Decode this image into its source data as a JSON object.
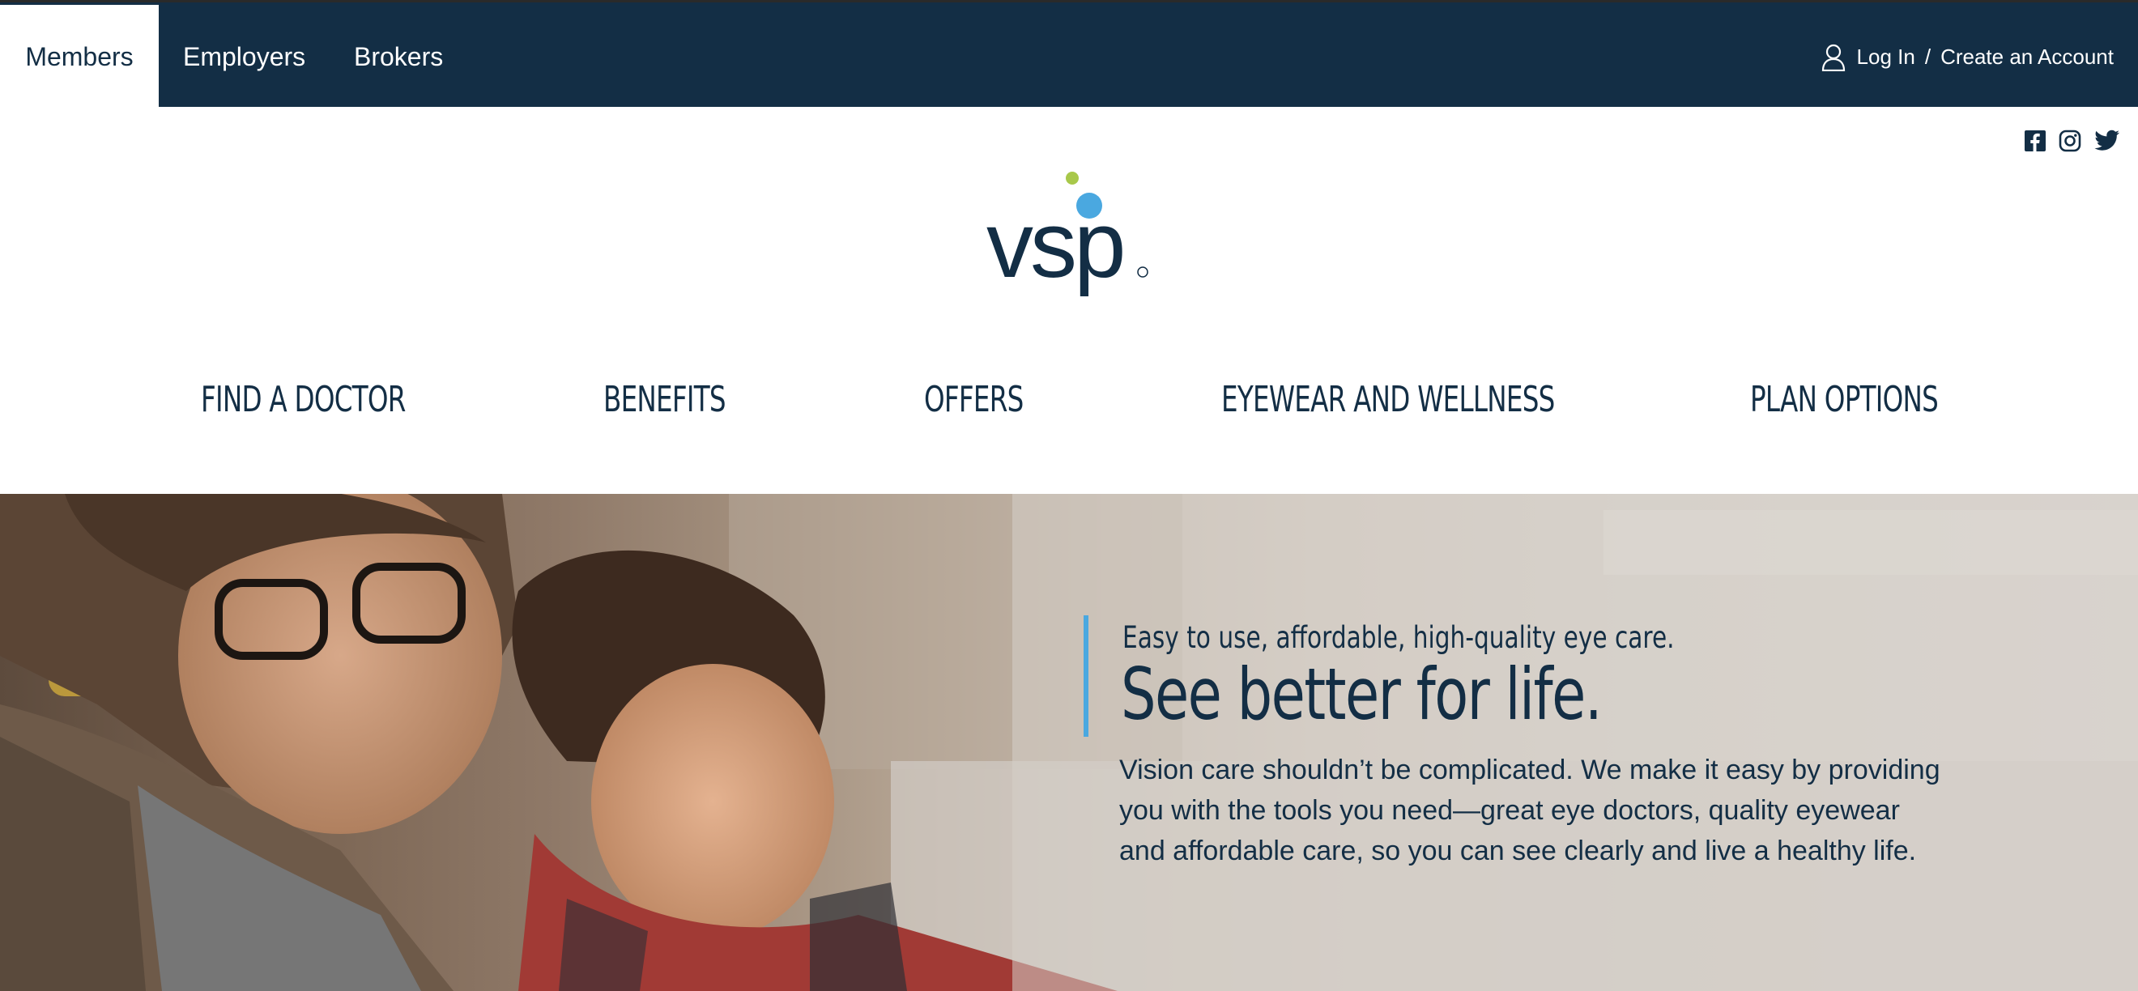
{
  "top_bar": {
    "audience_tabs": [
      {
        "label": "Members",
        "active": true
      },
      {
        "label": "Employers",
        "active": false
      },
      {
        "label": "Brokers",
        "active": false
      }
    ],
    "account": {
      "icon": "user-icon",
      "login_label": "Log In",
      "separator": "/",
      "create_label": "Create an Account"
    }
  },
  "social": [
    "facebook-icon",
    "instagram-icon",
    "twitter-icon"
  ],
  "logo": {
    "text": "vsp"
  },
  "main_nav": [
    {
      "label": "FIND A DOCTOR"
    },
    {
      "label": "BENEFITS"
    },
    {
      "label": "OFFERS"
    },
    {
      "label": "EYEWEAR AND WELLNESS"
    },
    {
      "label": "PLAN OPTIONS"
    }
  ],
  "hero": {
    "eyebrow": "Easy to use, affordable, high-quality eye care.",
    "headline": "See better for life.",
    "body": "Vision care shouldn’t be complicated. We make it easy by providing you with the tools you need—great eye doctors, quality eyewear and affordable care, so you can see clearly and live a healthy life.",
    "image": "father-and-son-smiling-photo"
  },
  "colors": {
    "navy": "#132e45",
    "accent_blue": "#4aa8e0",
    "logo_green": "#a8c84a",
    "white": "#ffffff"
  }
}
